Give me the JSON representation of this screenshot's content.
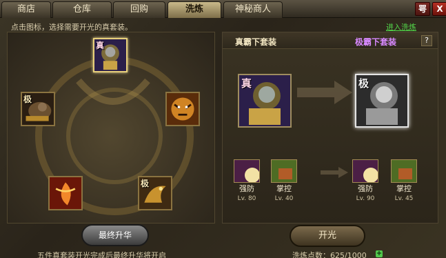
{
  "tabs": [
    {
      "label": "商店"
    },
    {
      "label": "仓库"
    },
    {
      "label": "回购"
    },
    {
      "label": "洗炼"
    },
    {
      "label": "神秘商人"
    }
  ],
  "help_button": "咢",
  "close_button": "X",
  "hint": "点击图标，选择需要开光的真套装。",
  "enter_link": "进入洗炼",
  "left": {
    "slots": [
      {
        "tag": "真",
        "icon": "warrior-helmet-icon"
      },
      {
        "tag": "极",
        "icon": "bear-armor-icon"
      },
      {
        "tag": "",
        "icon": "tiger-icon"
      },
      {
        "tag": "",
        "icon": "phoenix-icon"
      },
      {
        "tag": "极",
        "icon": "dragon-icon"
      }
    ],
    "final_button": "最终升华",
    "bottom_text": "五件真套装开光完成后最终升华将开启"
  },
  "right": {
    "source_name": "真霸下套装",
    "target_name": "极霸下套装",
    "help": "?",
    "source_tag": "真",
    "target_tag": "极",
    "skills_left": [
      {
        "name": "强防",
        "level": "Lv. 80"
      },
      {
        "name": "掌控",
        "level": "Lv. 40"
      }
    ],
    "skills_right": [
      {
        "name": "强防",
        "level": "Lv. 90"
      },
      {
        "name": "掌控",
        "level": "Lv. 45"
      }
    ],
    "open_button": "开光",
    "points": "洗炼点数：625/1000",
    "plus": "+"
  },
  "colors": {
    "link": "#53d94a",
    "target_name": "#d889ff"
  }
}
